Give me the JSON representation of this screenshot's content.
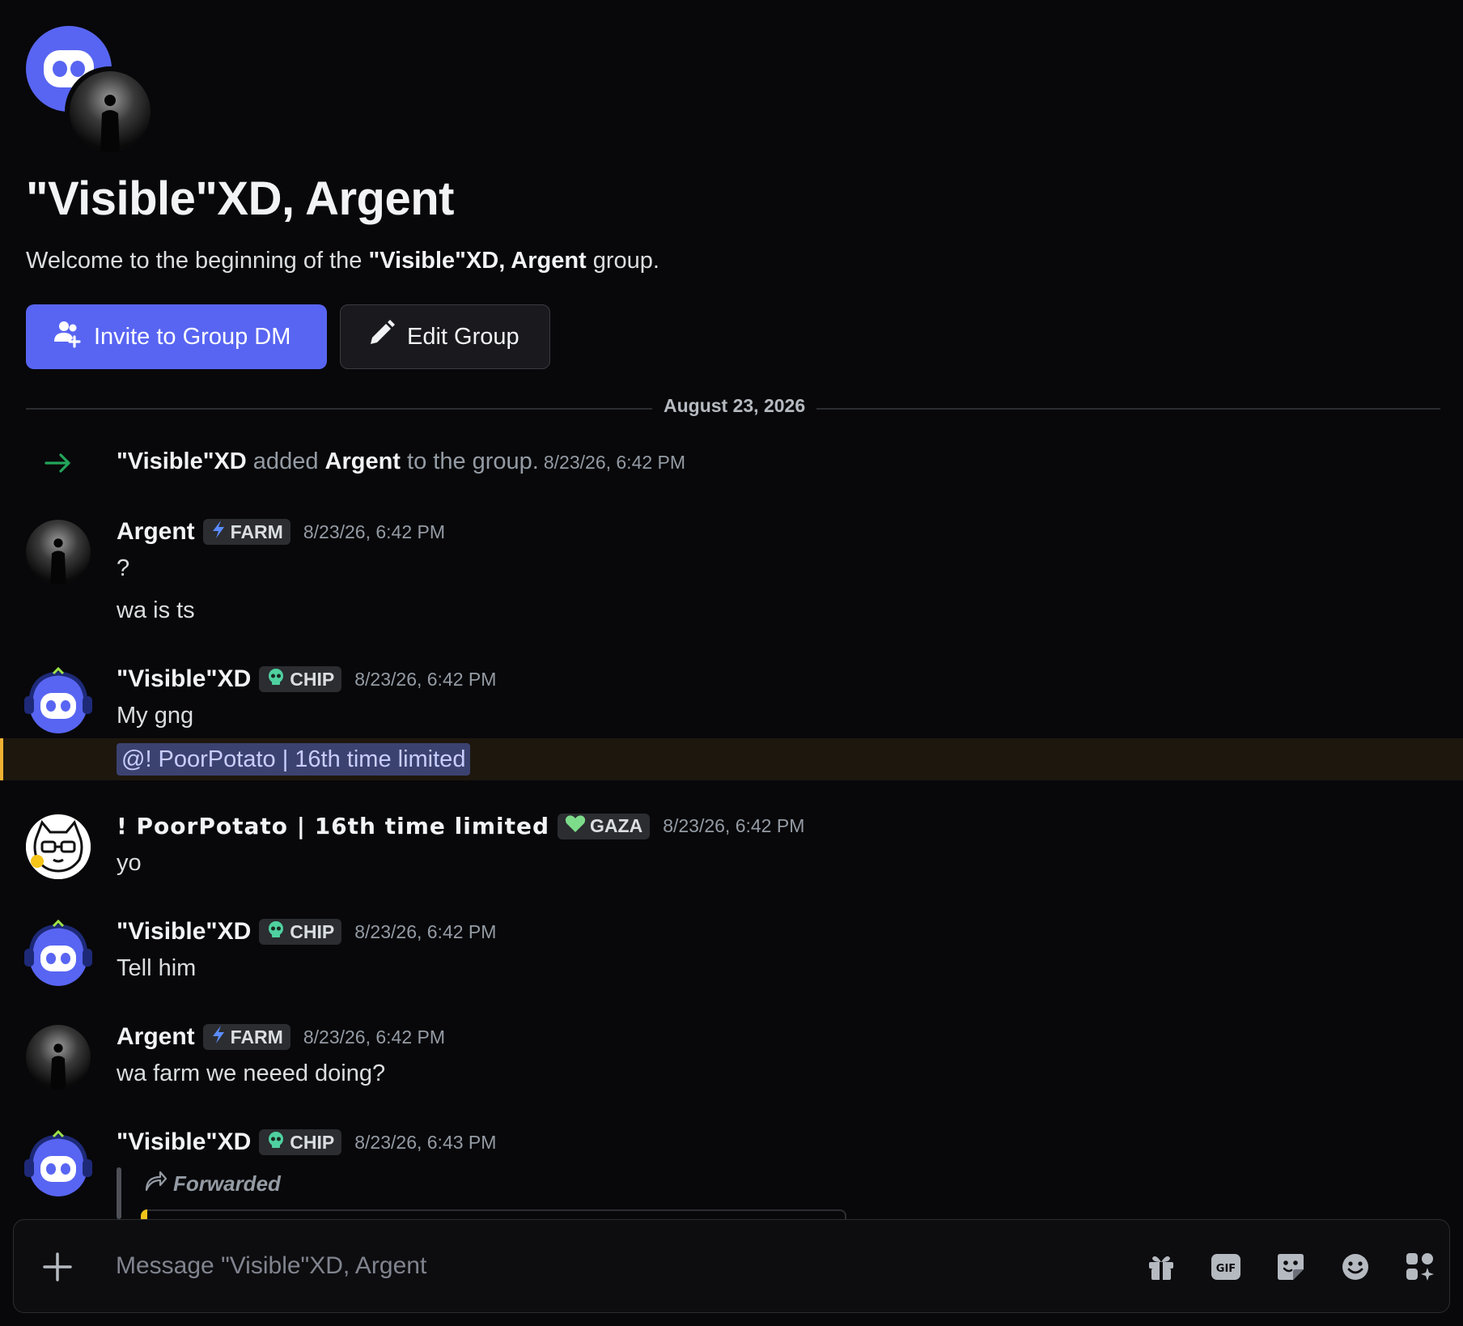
{
  "group": {
    "title": "\"Visible\"XD, Argent",
    "welcome_prefix": "Welcome to the beginning of the ",
    "welcome_name": "\"Visible\"XD, Argent",
    "welcome_suffix": " group."
  },
  "buttons": {
    "invite_label": "Invite to Group DM",
    "edit_label": "Edit Group"
  },
  "date_divider": "August 23, 2026",
  "system_message": {
    "actor": "\"Visible\"XD",
    "verb": " added ",
    "target": "Argent",
    "rest": " to the group.",
    "time": "8/23/26, 6:42 PM"
  },
  "messages": [
    {
      "author": "Argent",
      "tag": "FARM",
      "time": "8/23/26, 6:42 PM",
      "lines": [
        "?",
        "wa is ts"
      ]
    },
    {
      "author": "\"Visible\"XD",
      "tag": "CHIP",
      "time": "8/23/26, 6:42 PM",
      "lines": [
        "My gng"
      ],
      "mention": "@! PoorPotato | 16th time limited"
    },
    {
      "author": "! PoorPotato | 16th time limited",
      "tag": "GAZA",
      "time": "8/23/26, 6:42 PM",
      "lines": [
        "yo"
      ]
    },
    {
      "author": "\"Visible\"XD",
      "tag": "CHIP",
      "time": "8/23/26, 6:42 PM",
      "lines": [
        "Tell him"
      ]
    },
    {
      "author": "Argent",
      "tag": "FARM",
      "time": "8/23/26, 6:42 PM",
      "lines": [
        "wa farm we neeed doing?"
      ]
    },
    {
      "author": "\"Visible\"XD",
      "tag": "CHIP",
      "time": "8/23/26, 6:43 PM",
      "forwarded_label": "Forwarded"
    }
  ],
  "composer": {
    "placeholder": "Message \"Visible\"XD, Argent",
    "gif_label": "GIF"
  },
  "colors": {
    "background": "#08080a",
    "blurple": "#5865f2",
    "mention_bg": "#3c4270",
    "highlight_border": "#f0b232",
    "system_arrow": "#23a55a"
  }
}
